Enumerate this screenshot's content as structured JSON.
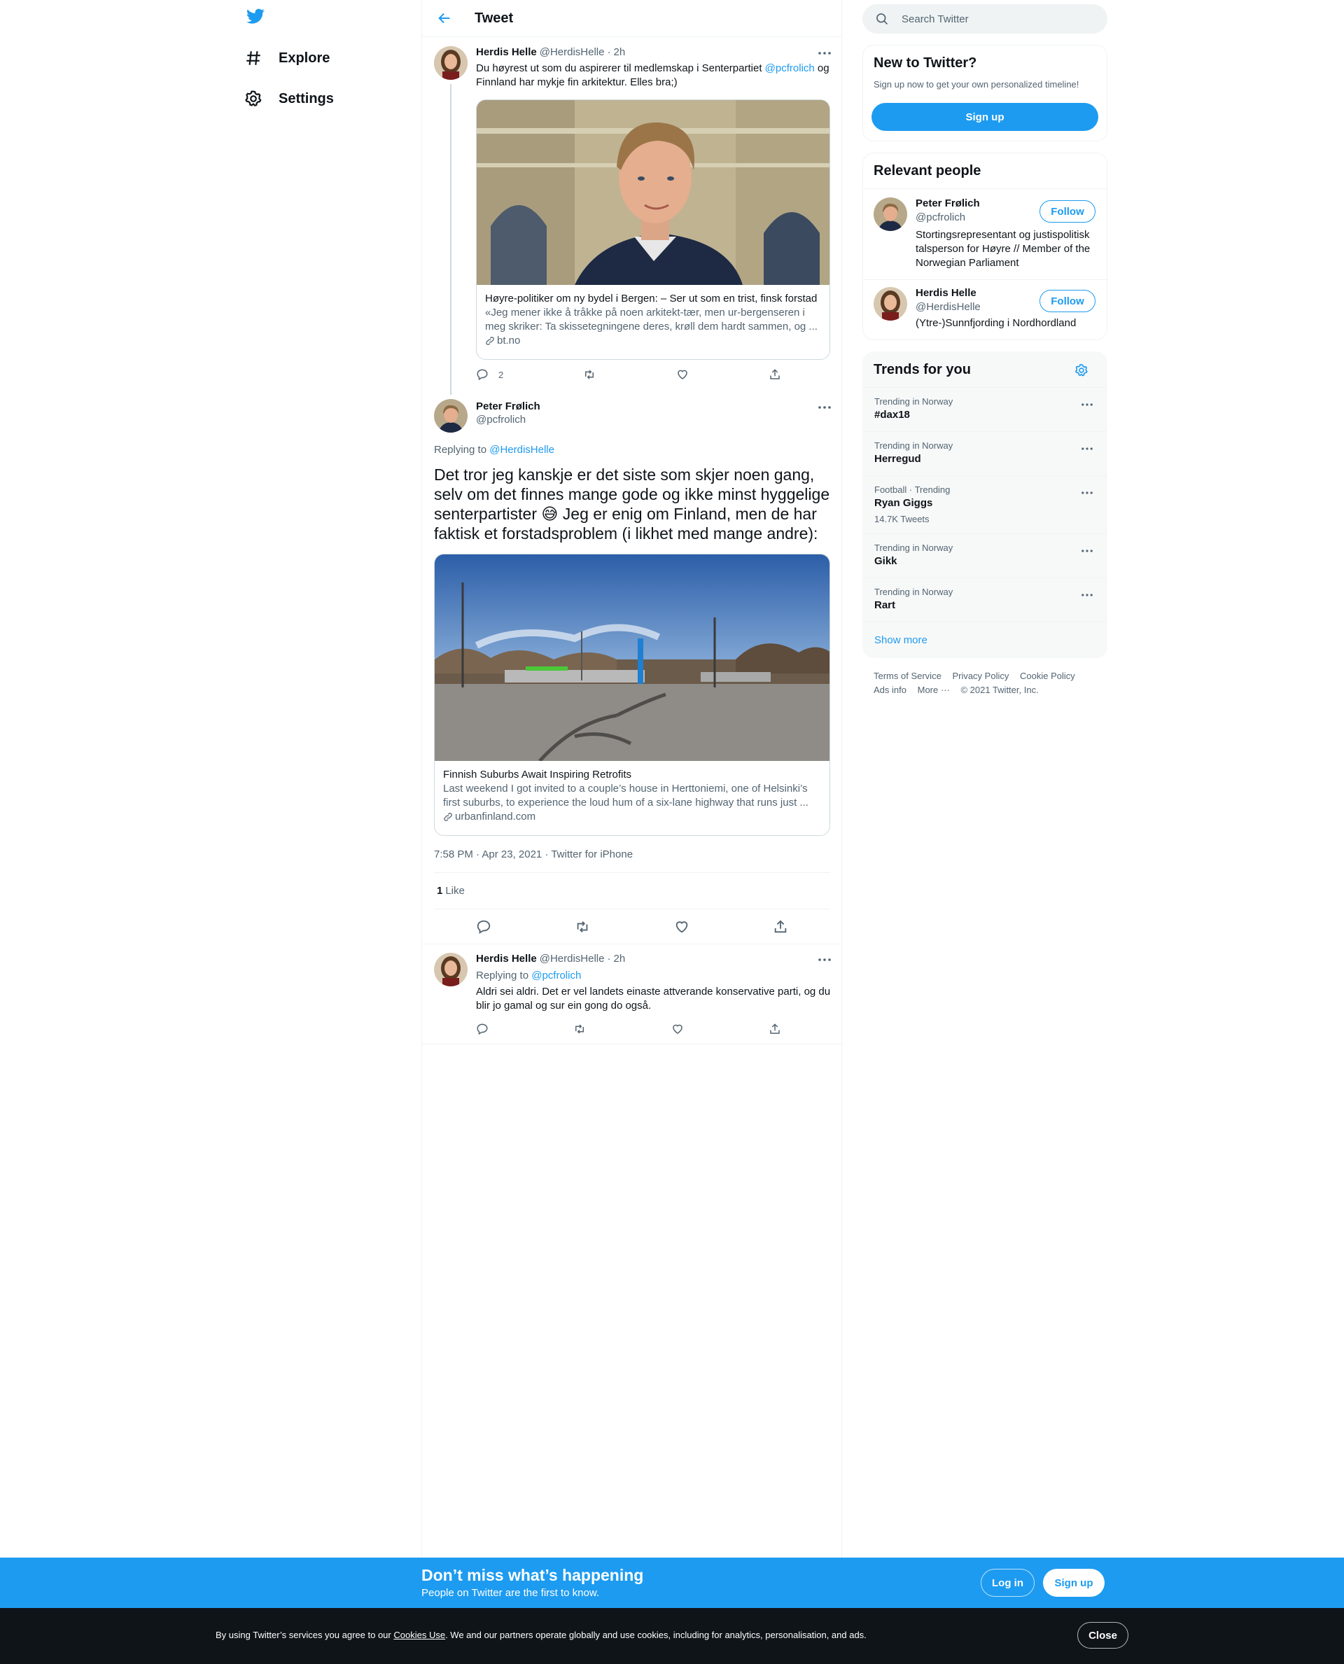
{
  "nav": {
    "explore": "Explore",
    "settings": "Settings"
  },
  "header": {
    "title": "Tweet"
  },
  "parent_tweet": {
    "name": "Herdis Helle",
    "handle": "@HerdisHelle",
    "sep": "·",
    "time": "2h",
    "text_a": "Du høyrest ut som du aspirerer til medlemskap i Senterpartiet ",
    "mention": "@pcfrolich",
    "text_b": " og Finnland har mykje fin arkitektur. Elles bra;)",
    "card_title": "Høyre-politiker om ny bydel i Bergen: – Ser ut som en trist, finsk forstad",
    "card_desc": "«Jeg mener ikke å tråkke på noen arkitekt-tær, men ur-bergenseren i meg skriker: Ta skissetegningene deres, krøll dem hardt sammen, og ...",
    "card_domain": "bt.no",
    "reply_count": "2"
  },
  "main_tweet": {
    "name": "Peter Frølich",
    "handle": "@pcfrolich",
    "replying_label": "Replying to ",
    "replying_to": "@HerdisHelle",
    "text_a": "Det tror jeg kanskje er det siste som skjer noen gang, selv om det finnes mange gode og ikke minst hyggelige senterpartister ",
    "emoji": "😅",
    "text_b": " Jeg er enig om Finland, men de har faktisk et forstadsproblem (i likhet med mange andre):",
    "card_title": "Finnish Suburbs Await Inspiring Retrofits",
    "card_desc": "Last weekend I got invited to a couple’s house in Herttoniemi, one of Helsinki’s first suburbs, to experience the loud hum of a six-lane highway that runs just ...",
    "card_domain": "urbanfinland.com",
    "timestamp": "7:58 PM · Apr 23, 2021 · Twitter for iPhone",
    "like_count": "1",
    "like_label": "Like"
  },
  "reply_tweet": {
    "name": "Herdis Helle",
    "handle": "@HerdisHelle",
    "sep": "·",
    "time": "2h",
    "replying_label": "Replying to ",
    "replying_to": "@pcfrolich",
    "text": "Aldri sei aldri. Det er vel landets einaste attverande konservative parti, og du blir jo gamal og sur ein gong do også."
  },
  "search": {
    "placeholder": "Search Twitter"
  },
  "new_to_twitter": {
    "title": "New to Twitter?",
    "subtitle": "Sign up now to get your own personalized timeline!",
    "signup": "Sign up"
  },
  "relevant_people": {
    "title": "Relevant people",
    "people": [
      {
        "name": "Peter Frølich",
        "handle": "@pcfrolich",
        "follow": "Follow",
        "bio": "Stortingsrepresentant og justispolitisk talsperson for Høyre // Member of the Norwegian Parliament"
      },
      {
        "name": "Herdis Helle",
        "handle": "@HerdisHelle",
        "follow": "Follow",
        "bio": "(Ytre-)Sunnfjording i Nordhordland"
      }
    ]
  },
  "trends": {
    "title": "Trends for you",
    "items": [
      {
        "context": "Trending in Norway",
        "name": "#dax18",
        "count": ""
      },
      {
        "context": "Trending in Norway",
        "name": "Herregud",
        "count": ""
      },
      {
        "context": "Football · Trending",
        "name": "Ryan Giggs",
        "count": "14.7K Tweets"
      },
      {
        "context": "Trending in Norway",
        "name": "Gikk",
        "count": ""
      },
      {
        "context": "Trending in Norway",
        "name": "Rart",
        "count": ""
      }
    ],
    "show_more": "Show more"
  },
  "footer": {
    "terms": "Terms of Service",
    "privacy": "Privacy Policy",
    "cookie": "Cookie Policy",
    "ads": "Ads info",
    "more": "More ···",
    "copyright": "© 2021 Twitter, Inc."
  },
  "bottom_bar": {
    "title": "Don’t miss what’s happening",
    "subtitle": "People on Twitter are the first to know.",
    "login": "Log in",
    "signup": "Sign up"
  },
  "cookie_bar": {
    "text_a": "By using Twitter’s services you agree to our ",
    "link": "Cookies Use",
    "text_b": ". We and our partners operate globally and use cookies, including for analytics, personalisation, and ads.",
    "close": "Close"
  },
  "colors": {
    "accent": "#1d9bf0",
    "text": "#0f1419",
    "muted": "#536471",
    "cookie_bg": "#0f1419"
  }
}
